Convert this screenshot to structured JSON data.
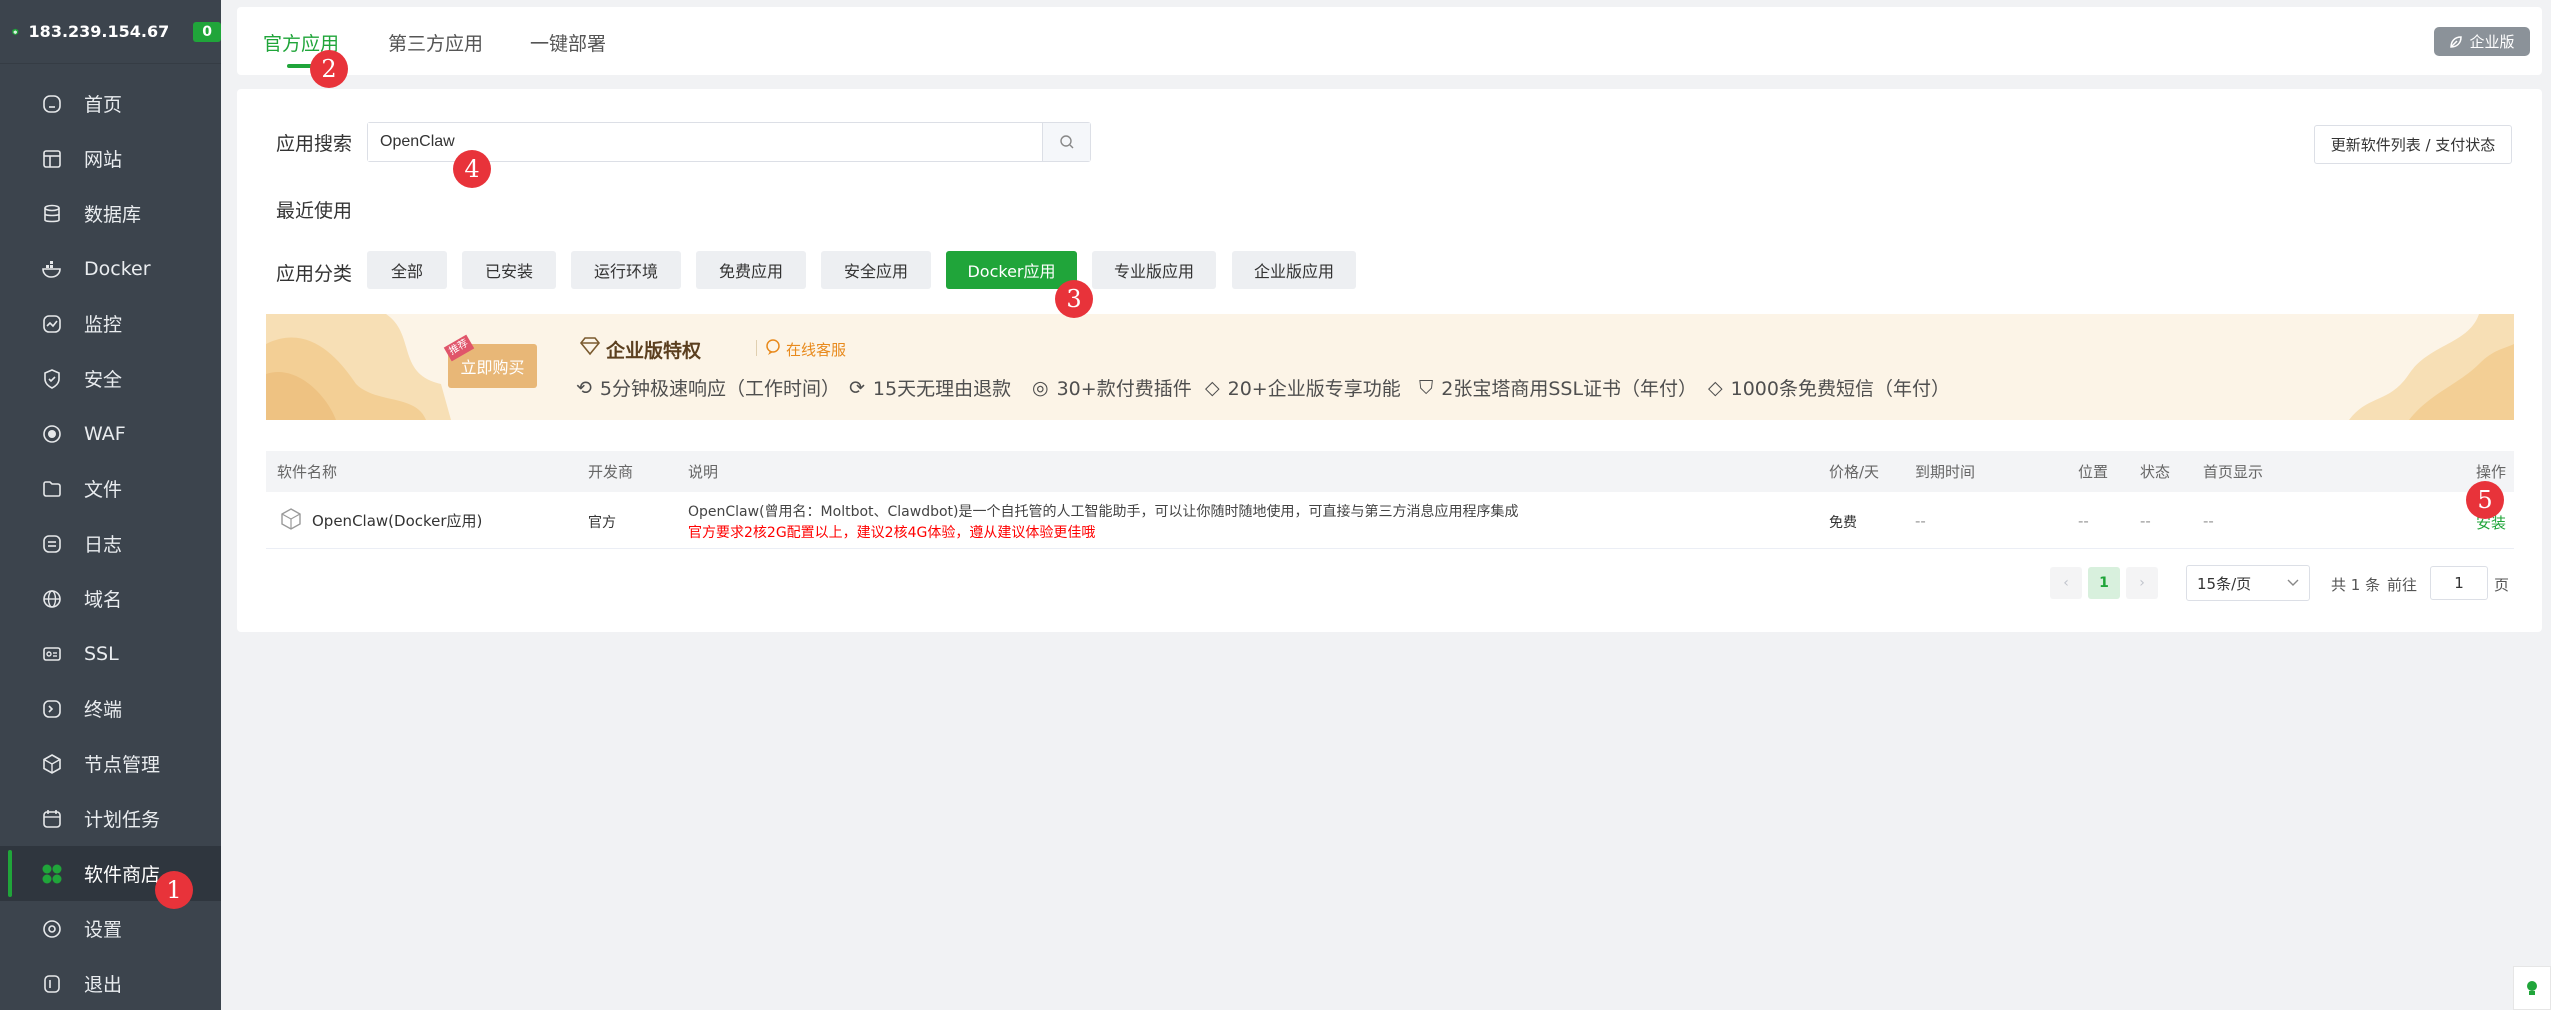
{
  "sidebar": {
    "ip": "183.239.154.67",
    "badge": "0",
    "items": [
      {
        "label": "首页",
        "icon": "home-icon"
      },
      {
        "label": "网站",
        "icon": "website-icon"
      },
      {
        "label": "数据库",
        "icon": "database-icon"
      },
      {
        "label": "Docker",
        "icon": "docker-icon"
      },
      {
        "label": "监控",
        "icon": "monitor-icon"
      },
      {
        "label": "安全",
        "icon": "shield-icon"
      },
      {
        "label": "WAF",
        "icon": "waf-icon"
      },
      {
        "label": "文件",
        "icon": "folder-icon"
      },
      {
        "label": "日志",
        "icon": "log-icon"
      },
      {
        "label": "域名",
        "icon": "globe-icon"
      },
      {
        "label": "SSL",
        "icon": "ssl-icon"
      },
      {
        "label": "终端",
        "icon": "terminal-icon"
      },
      {
        "label": "节点管理",
        "icon": "node-icon"
      },
      {
        "label": "计划任务",
        "icon": "calendar-icon"
      },
      {
        "label": "软件商店",
        "icon": "app-store-icon",
        "active": true
      },
      {
        "label": "设置",
        "icon": "settings-icon"
      },
      {
        "label": "退出",
        "icon": "logout-icon"
      }
    ]
  },
  "tabs": {
    "official": "官方应用",
    "third_party": "第三方应用",
    "one_click": "一键部署",
    "enterprise_button": "企业版"
  },
  "search": {
    "label": "应用搜索",
    "value": "OpenClaw",
    "refresh_button": "更新软件列表 / 支付状态"
  },
  "recent": {
    "label": "最近使用"
  },
  "categories": {
    "label": "应用分类",
    "items": [
      "全部",
      "已安装",
      "运行环境",
      "免费应用",
      "安全应用",
      "Docker应用",
      "专业版应用",
      "企业版应用"
    ],
    "active": "Docker应用"
  },
  "banner": {
    "hot_tag": "推荐",
    "buy_button": "立即购买",
    "title": "企业版特权",
    "service": "在线客服",
    "features": [
      "5分钟极速响应（工作时间）",
      "15天无理由退款",
      "30+款付费插件",
      "20+企业版专享功能",
      "2张宝塔商用SSL证书（年付）",
      "1000条免费短信（年付）"
    ]
  },
  "table": {
    "headers": {
      "name": "软件名称",
      "developer": "开发商",
      "description": "说明",
      "price": "价格/天",
      "expire": "到期时间",
      "location": "位置",
      "status": "状态",
      "homepage": "首页显示",
      "action": "操作"
    },
    "rows": [
      {
        "name": "OpenClaw(Docker应用)",
        "developer": "官方",
        "description": "OpenClaw(曾用名：Moltbot、Clawdbot)是一个自托管的人工智能助手，可以让你随时随地使用，可直接与第三方消息应用程序集成",
        "warning": "官方要求2核2G配置以上，建议2核4G体验，遵从建议体验更佳哦",
        "price": "免费",
        "expire": "--",
        "location": "--",
        "status": "--",
        "homepage": "--",
        "action": "安装"
      }
    ]
  },
  "pagination": {
    "prev": "‹",
    "current": "1",
    "next": "›",
    "page_size": "15条/页",
    "total": "共 1 条",
    "goto_label": "前往",
    "goto_value": "1",
    "page_unit": "页"
  },
  "markers": [
    "1",
    "2",
    "3",
    "4",
    "5"
  ],
  "colors": {
    "accent": "#20a53a",
    "sidebar": "#3c444d",
    "marker": "#e8333a",
    "warning": "#ff0000"
  }
}
